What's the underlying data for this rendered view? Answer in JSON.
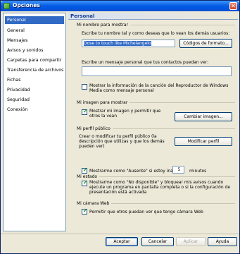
{
  "window": {
    "title": "Opciones",
    "close_glyph": "✕"
  },
  "sidebar": {
    "items": [
      {
        "label": "Personal",
        "selected": true
      },
      {
        "label": "General"
      },
      {
        "label": "Mensajes"
      },
      {
        "label": "Avisos y sonidos"
      },
      {
        "label": "Carpetas para compartir"
      },
      {
        "label": "Transferencia de archivos"
      },
      {
        "label": "Fichas"
      },
      {
        "label": "Privacidad"
      },
      {
        "label": "Seguridad"
      },
      {
        "label": "Conexión"
      }
    ]
  },
  "panel": {
    "header": "Personal",
    "name_group": {
      "title": "Mi nombre para mostrar",
      "name_prompt": "Escribe tu nombre tal y como deseas que lo vean los demás usuarios:",
      "name_value": "Dose to touch like Michelangelo",
      "format_button": "Códigos de formato...",
      "message_prompt": "Escribe un mensaje personal que tus contactos puedan ver:",
      "message_value": "",
      "media_checkbox_label": "Mostrar la información de la canción del Reproductor de Windows Media como mensaje personal",
      "media_checked": false
    },
    "image_group": {
      "title": "Mi imagen para mostrar",
      "show_image_label": "Mostrar mi imagen y permitir que otros la vean",
      "show_image_checked": true,
      "change_image_button": "Cambiar imagen..."
    },
    "profile_group": {
      "title": "Mi perfil público",
      "description": "Crear o modificar tu perfil público (la descripción que utilizas y que los demás pueden ver)",
      "modify_button": "Modificar perfil"
    },
    "status_group": {
      "title": "Mi estado",
      "away_label": "Mostrarme como \"Ausente\" si estoy inactivo",
      "away_checked": true,
      "away_minutes": "5",
      "minutes_label": "minutos",
      "busy_label": "Mostrarme como \"No disponible\" y bloquear mis avisos cuando ejecute un programa en pantalla completa o si la configuración de presentación está activada",
      "busy_checked": true
    },
    "webcam_group": {
      "title": "Mi cámara Web",
      "webcam_label": "Permitir que otros puedan ver que tengo cámara Web",
      "webcam_checked": true
    }
  },
  "footer": {
    "accept": "Aceptar",
    "cancel": "Cancelar",
    "apply": "Aplicar",
    "help": "Ayuda",
    "apply_disabled": true
  },
  "check_glyph": "✔"
}
